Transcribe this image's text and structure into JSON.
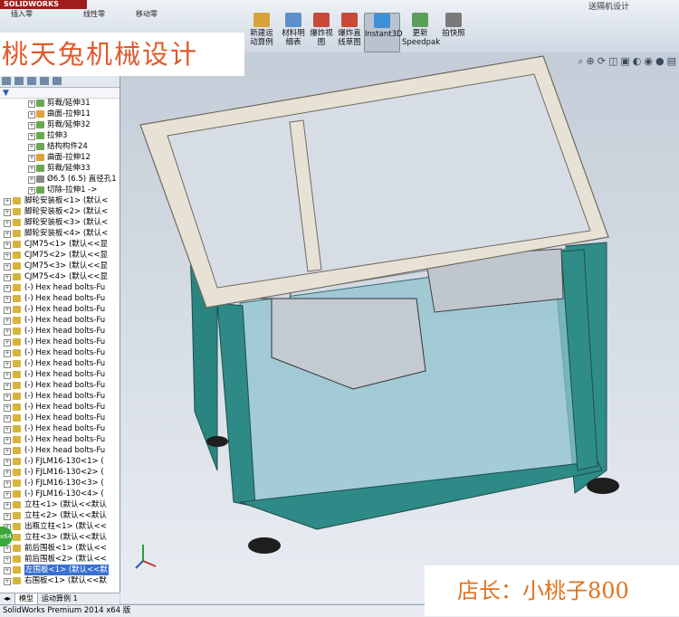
{
  "app": {
    "brand": "SOLIDWORKS",
    "doc_title": "送隔机设计"
  },
  "toolbar": {
    "top_labels": [
      "插入零",
      "线性零",
      "移动零"
    ],
    "buttons": [
      {
        "label_line1": "新建运",
        "label_line2": "动算例"
      },
      {
        "label_line1": "材料明",
        "label_line2": "细表"
      },
      {
        "label_line1": "爆炸视",
        "label_line2": "图"
      },
      {
        "label_line1": "爆炸直",
        "label_line2": "线草图"
      },
      {
        "label_line1": "Instant3D",
        "label_line2": ""
      },
      {
        "label_line1": "更新",
        "label_line2": "Speedpak"
      },
      {
        "label_line1": "拍快照",
        "label_line2": ""
      }
    ]
  },
  "watermarks": {
    "top": "桃天兔机械设计",
    "bottom": "店长：小桃子800"
  },
  "tree": {
    "items": [
      {
        "label": "剪裁/延伸31",
        "icon": "feature-icon"
      },
      {
        "label": "曲面-拉伸11",
        "icon": "surface-icon"
      },
      {
        "label": "剪裁/延伸32",
        "icon": "feature-icon"
      },
      {
        "label": "拉伸3",
        "icon": "feature-icon"
      },
      {
        "label": "结构构件24",
        "icon": "feature-icon"
      },
      {
        "label": "曲面-拉伸12",
        "icon": "surface-icon"
      },
      {
        "label": "剪裁/延伸33",
        "icon": "feature-icon"
      },
      {
        "label": "Ø6.5 (6.5) 直径孔1",
        "icon": "hole-icon"
      },
      {
        "label": "切除-拉伸1 ->",
        "icon": "feature-icon"
      },
      {
        "label": "脚轮安装板<1> (默认<",
        "icon": "part-icon"
      },
      {
        "label": "脚轮安装板<2> (默认<",
        "icon": "part-icon"
      },
      {
        "label": "脚轮安装板<3> (默认<",
        "icon": "part-icon"
      },
      {
        "label": "脚轮安装板<4> (默认<",
        "icon": "part-icon"
      },
      {
        "label": "CJM75<1> (默认<<显",
        "icon": "part-icon"
      },
      {
        "label": "CJM75<2> (默认<<显",
        "icon": "part-icon"
      },
      {
        "label": "CJM75<3> (默认<<显",
        "icon": "part-icon"
      },
      {
        "label": "CJM75<4> (默认<<显",
        "icon": "part-icon"
      },
      {
        "label": "(-) Hex head bolts-Fu",
        "icon": "part-icon"
      },
      {
        "label": "(-) Hex head bolts-Fu",
        "icon": "part-icon"
      },
      {
        "label": "(-) Hex head bolts-Fu",
        "icon": "part-icon"
      },
      {
        "label": "(-) Hex head bolts-Fu",
        "icon": "part-icon"
      },
      {
        "label": "(-) Hex head bolts-Fu",
        "icon": "part-icon"
      },
      {
        "label": "(-) Hex head bolts-Fu",
        "icon": "part-icon"
      },
      {
        "label": "(-) Hex head bolts-Fu",
        "icon": "part-icon"
      },
      {
        "label": "(-) Hex head bolts-Fu",
        "icon": "part-icon"
      },
      {
        "label": "(-) Hex head bolts-Fu",
        "icon": "part-icon"
      },
      {
        "label": "(-) Hex head bolts-Fu",
        "icon": "part-icon"
      },
      {
        "label": "(-) Hex head bolts-Fu",
        "icon": "part-icon"
      },
      {
        "label": "(-) Hex head bolts-Fu",
        "icon": "part-icon"
      },
      {
        "label": "(-) Hex head bolts-Fu",
        "icon": "part-icon"
      },
      {
        "label": "(-) Hex head bolts-Fu",
        "icon": "part-icon"
      },
      {
        "label": "(-) Hex head bolts-Fu",
        "icon": "part-icon"
      },
      {
        "label": "(-) Hex head bolts-Fu",
        "icon": "part-icon"
      },
      {
        "label": "(-) FJLM16-130<1> (",
        "icon": "part-icon"
      },
      {
        "label": "(-) FJLM16-130<2> (",
        "icon": "part-icon"
      },
      {
        "label": "(-) FJLM16-130<3> (",
        "icon": "part-icon"
      },
      {
        "label": "(-) FJLM16-130<4> (",
        "icon": "part-icon"
      },
      {
        "label": "立柱<1> (默认<<默认",
        "icon": "part-icon"
      },
      {
        "label": "立柱<2> (默认<<默认",
        "icon": "part-icon"
      },
      {
        "label": "出瓶立柱<1> (默认<<",
        "icon": "part-icon"
      },
      {
        "label": "立柱<3> (默认<<默认",
        "icon": "part-icon"
      },
      {
        "label": "前后围板<1> (默认<<",
        "icon": "part-icon"
      },
      {
        "label": "前后围板<2> (默认<<",
        "icon": "part-icon"
      },
      {
        "label": "左围板<1> (默认<<默",
        "icon": "part-icon",
        "selected": true
      },
      {
        "label": "右围板<1> (默认<<默",
        "icon": "part-icon"
      }
    ]
  },
  "tabs": {
    "model": "模型",
    "motion": "运动算例 1"
  },
  "status": {
    "text": "SolidWorks Premium 2014 x64 版"
  },
  "colors": {
    "frame_top": "#e8e2d6",
    "frame_side": "#2e8a86",
    "glass": "#9ccdd8",
    "selection": "#3b6fd0"
  }
}
